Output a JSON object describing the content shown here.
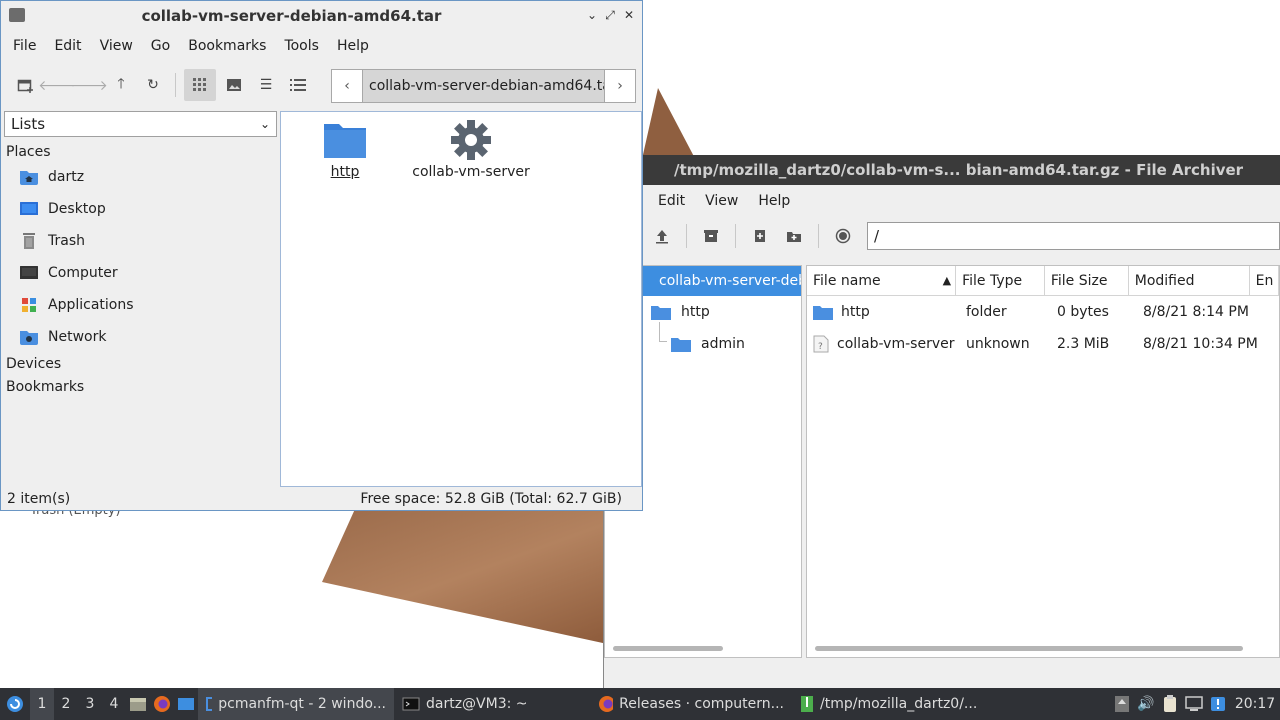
{
  "file_manager": {
    "title": "collab-vm-server-debian-amd64.tar",
    "menu": [
      "File",
      "Edit",
      "View",
      "Go",
      "Bookmarks",
      "Tools",
      "Help"
    ],
    "path_crumb": "collab-vm-server-debian-amd64.tar",
    "side_pane_mode": "Lists",
    "places_header": "Places",
    "places": [
      {
        "label": "dartz",
        "icon": "home-folder-icon"
      },
      {
        "label": "Desktop",
        "icon": "desktop-icon"
      },
      {
        "label": "Trash",
        "icon": "trash-icon"
      },
      {
        "label": "Computer",
        "icon": "computer-icon"
      },
      {
        "label": "Applications",
        "icon": "applications-icon"
      },
      {
        "label": "Network",
        "icon": "network-icon"
      }
    ],
    "devices_header": "Devices",
    "bookmarks_header": "Bookmarks",
    "items": [
      {
        "name": "http",
        "icon": "folder-icon"
      },
      {
        "name": "collab-vm-server",
        "icon": "gear-icon"
      }
    ],
    "status_count": "2 item(s)",
    "status_free": "Free space: 52.8 GiB (Total: 62.7 GiB)"
  },
  "archiver": {
    "title": "/tmp/mozilla_dartz0/collab-vm-s... bian-amd64.tar.gz - File Archiver",
    "menu": [
      "Edit",
      "View",
      "Help"
    ],
    "location": "/",
    "tree": {
      "root": "collab-vm-server-deb",
      "child": "http",
      "grandchild": "admin"
    },
    "columns": [
      "File name",
      "File Type",
      "File Size",
      "Modified",
      "En"
    ],
    "rows": [
      {
        "name": "http",
        "type": "folder",
        "size": "0 bytes",
        "modified": "8/8/21 8:14 PM",
        "icon": "folder-icon"
      },
      {
        "name": "collab-vm-server",
        "type": "unknown",
        "size": "2.3 MiB",
        "modified": "8/8/21 10:34 PM",
        "icon": "unknown-file-icon"
      }
    ]
  },
  "desktop": {
    "trash_label": "Trash (Empty)"
  },
  "taskbar": {
    "workspaces": [
      "1",
      "2",
      "3",
      "4"
    ],
    "tasks": [
      {
        "label": "pcmanfm-qt - 2 windo...",
        "icon": "folder-icon"
      },
      {
        "label": "dartz@VM3: ~",
        "icon": "terminal-icon"
      },
      {
        "label": "Releases · computern...",
        "icon": "firefox-icon"
      },
      {
        "label": "/tmp/mozilla_dartz0/...",
        "icon": "archive-icon"
      }
    ],
    "clock": "20:17"
  },
  "colors": {
    "folder_blue": "#4a8fe0",
    "selection_blue": "#3d8ee0",
    "taskbar_bg": "#2f3136"
  }
}
